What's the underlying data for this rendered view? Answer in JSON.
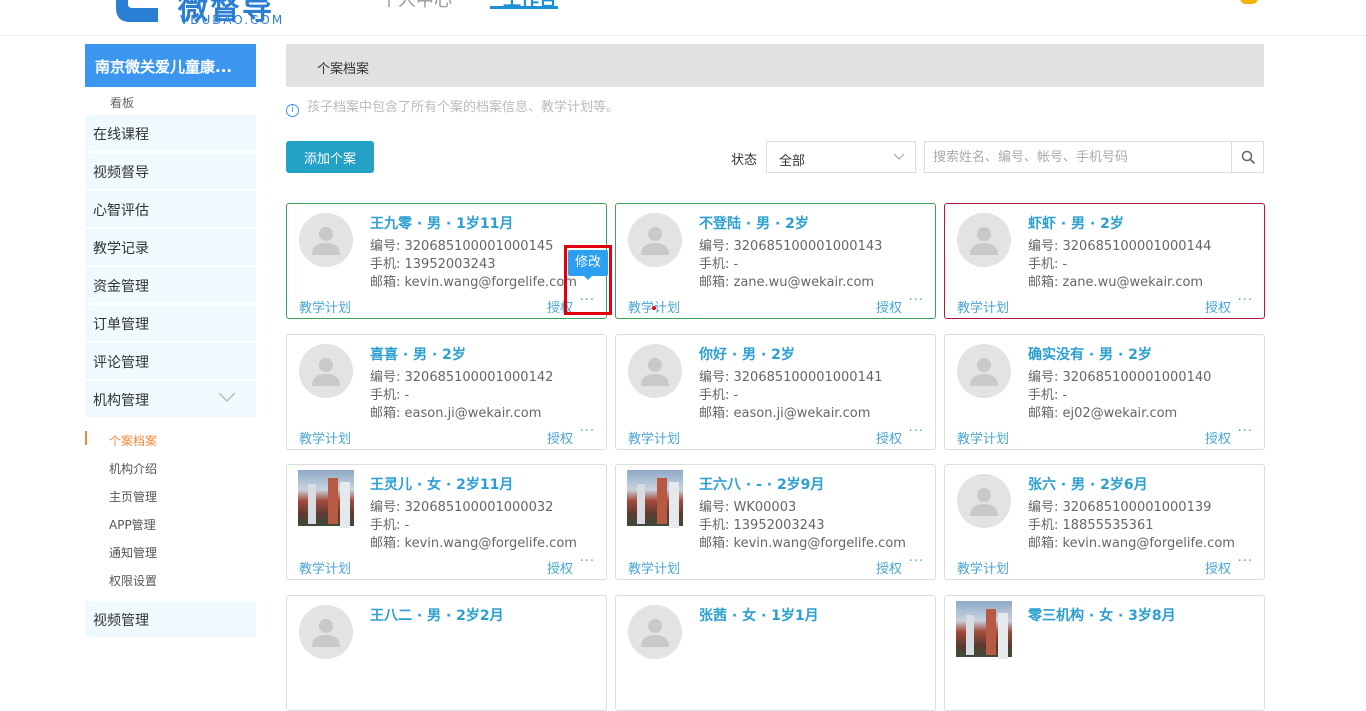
{
  "header": {
    "logo_text": "微督导",
    "logo_sub": "VDUDAO.COM",
    "nav": [
      {
        "label": "个人中心"
      },
      {
        "label": "工作台"
      }
    ]
  },
  "sidebar": {
    "org_name": "南京微关爱儿童康...",
    "board_label": "看板",
    "menu": [
      {
        "label": "在线课程"
      },
      {
        "label": "视频督导"
      },
      {
        "label": "心智评估"
      },
      {
        "label": "教学记录"
      },
      {
        "label": "资金管理"
      },
      {
        "label": "订单管理"
      },
      {
        "label": "评论管理"
      },
      {
        "label": "机构管理"
      }
    ],
    "subs": [
      {
        "label": "个案档案"
      },
      {
        "label": "机构介绍"
      },
      {
        "label": "主页管理"
      },
      {
        "label": "APP管理"
      },
      {
        "label": "通知管理"
      },
      {
        "label": "权限设置"
      }
    ],
    "bottom_menu": "视频管理"
  },
  "main": {
    "breadcrumb": "个案档案",
    "tip": "孩子档案中包含了所有个案的档案信息、教学计划等。",
    "add_button": "添加个案",
    "status_label": "状态",
    "status_value": "全部",
    "search_placeholder": "搜索姓名、编号、帐号、手机号码",
    "card_plan_label": "教学计划",
    "card_auth_label": "授权",
    "card_more": "···",
    "edit_tooltip": "修改",
    "cards": [
      {
        "name": "王九零 · 男 · 1岁11月",
        "code": "编号: 320685100001000145",
        "phone": "手机: 13952003243",
        "email": "邮箱: kevin.wang@forgelife.com"
      },
      {
        "name": "不登陆 · 男 · 2岁",
        "code": "编号: 320685100001000143",
        "phone": "手机: -",
        "email": "邮箱: zane.wu@wekair.com"
      },
      {
        "name": "虾虾 · 男 · 2岁",
        "code": "编号: 320685100001000144",
        "phone": "手机: -",
        "email": "邮箱: zane.wu@wekair.com"
      },
      {
        "name": "喜喜 · 男 · 2岁",
        "code": "编号: 320685100001000142",
        "phone": "手机: -",
        "email": "邮箱: eason.ji@wekair.com"
      },
      {
        "name": "你好 · 男 · 2岁",
        "code": "编号: 320685100001000141",
        "phone": "手机: -",
        "email": "邮箱: eason.ji@wekair.com"
      },
      {
        "name": "确实没有 · 男 · 2岁",
        "code": "编号: 320685100001000140",
        "phone": "手机: -",
        "email": "邮箱: ej02@wekair.com"
      },
      {
        "name": "王灵儿 · 女 · 2岁11月",
        "code": "编号: 320685100001000032",
        "phone": "手机: -",
        "email": "邮箱: kevin.wang@forgelife.com"
      },
      {
        "name": "王六八 · - · 2岁9月",
        "code": "编号: WK00003",
        "phone": "手机: 13952003243",
        "email": "邮箱: kevin.wang@forgelife.com"
      },
      {
        "name": "张六 · 男 · 2岁6月",
        "code": "编号: 320685100001000139",
        "phone": "手机: 18855535361",
        "email": "邮箱: kevin.wang@forgelife.com"
      },
      {
        "name": "王八二 · 男 · 2岁2月"
      },
      {
        "name": "张茜 · 女 · 1岁1月"
      },
      {
        "name": "零三机构 · 女 · 3岁8月"
      }
    ]
  },
  "colors": {
    "accent": "#3b96f0",
    "card_green": "#3aa15a",
    "card_red": "#b0193e",
    "active_sub": "#f08a3c",
    "highlight": "#e00010"
  }
}
